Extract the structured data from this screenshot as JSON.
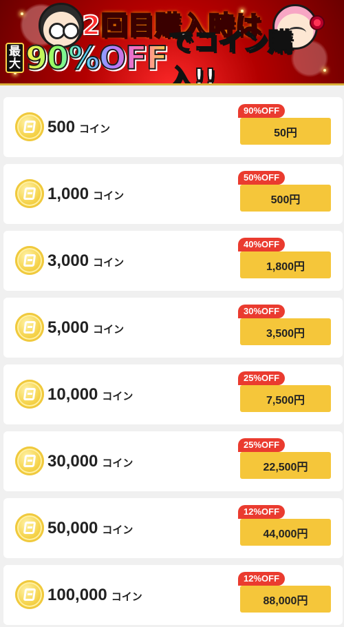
{
  "banner": {
    "title_line1_prefix": "2",
    "title_line1_rest": "回目購入時は",
    "max_label_1": "最",
    "max_label_2": "大",
    "discount": "90%OFF",
    "suffix": "でコイン購入!!"
  },
  "colors": {
    "accent_yellow": "#f5c63a",
    "discount_red": "#ea3b2f",
    "banner_red": "#b30000",
    "page_bg": "#f0f0f0"
  },
  "coin_icon_name": "coin-icon",
  "items": [
    {
      "qty": "500",
      "unit": "コイン",
      "discount": "90%OFF",
      "price": "50円"
    },
    {
      "qty": "1,000",
      "unit": "コイン",
      "discount": "50%OFF",
      "price": "500円"
    },
    {
      "qty": "3,000",
      "unit": "コイン",
      "discount": "40%OFF",
      "price": "1,800円"
    },
    {
      "qty": "5,000",
      "unit": "コイン",
      "discount": "30%OFF",
      "price": "3,500円"
    },
    {
      "qty": "10,000",
      "unit": "コイン",
      "discount": "25%OFF",
      "price": "7,500円"
    },
    {
      "qty": "30,000",
      "unit": "コイン",
      "discount": "25%OFF",
      "price": "22,500円"
    },
    {
      "qty": "50,000",
      "unit": "コイン",
      "discount": "12%OFF",
      "price": "44,000円"
    },
    {
      "qty": "100,000",
      "unit": "コイン",
      "discount": "12%OFF",
      "price": "88,000円"
    }
  ]
}
